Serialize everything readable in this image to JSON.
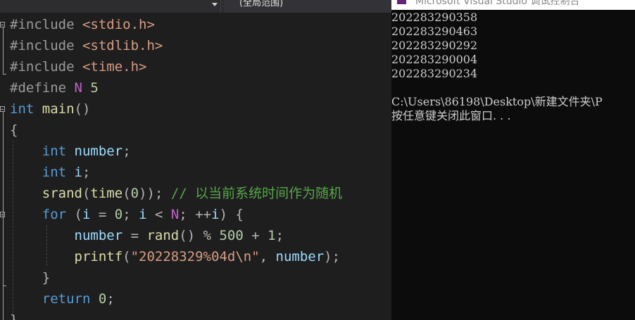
{
  "editor": {
    "function_scope": "(全局范围)",
    "code_lines": [
      {
        "tokens": [
          {
            "t": "#include ",
            "c": "pp"
          },
          {
            "t": "<stdio.h>",
            "c": "inc"
          }
        ]
      },
      {
        "tokens": [
          {
            "t": "#include ",
            "c": "pp"
          },
          {
            "t": "<stdlib.h>",
            "c": "inc"
          }
        ]
      },
      {
        "tokens": [
          {
            "t": "#include ",
            "c": "pp"
          },
          {
            "t": "<time.h>",
            "c": "inc"
          }
        ]
      },
      {
        "tokens": [
          {
            "t": "#define ",
            "c": "pp"
          },
          {
            "t": "N",
            "c": "macro"
          },
          {
            "t": " 5",
            "c": "num"
          }
        ]
      },
      {
        "tokens": [
          {
            "t": "int",
            "c": "kw"
          },
          {
            "t": " ",
            "c": ""
          },
          {
            "t": "main",
            "c": "fn"
          },
          {
            "t": "()",
            "c": "punc"
          }
        ]
      },
      {
        "tokens": [
          {
            "t": "{",
            "c": "punc"
          }
        ]
      },
      {
        "tokens": [
          {
            "t": "    ",
            "c": ""
          },
          {
            "t": "int",
            "c": "kw"
          },
          {
            "t": " ",
            "c": ""
          },
          {
            "t": "number",
            "c": "var"
          },
          {
            "t": ";",
            "c": "punc"
          }
        ]
      },
      {
        "tokens": [
          {
            "t": "    ",
            "c": ""
          },
          {
            "t": "int",
            "c": "kw"
          },
          {
            "t": " ",
            "c": ""
          },
          {
            "t": "i",
            "c": "var"
          },
          {
            "t": ";",
            "c": "punc"
          }
        ]
      },
      {
        "tokens": [
          {
            "t": "    ",
            "c": ""
          },
          {
            "t": "srand",
            "c": "fn"
          },
          {
            "t": "(",
            "c": "punc"
          },
          {
            "t": "time",
            "c": "fn"
          },
          {
            "t": "(",
            "c": "punc"
          },
          {
            "t": "0",
            "c": "num"
          },
          {
            "t": "));",
            "c": "punc"
          },
          {
            "t": " // 以当前系统时间作为随机",
            "c": "cmt"
          }
        ]
      },
      {
        "tokens": [
          {
            "t": "    ",
            "c": ""
          },
          {
            "t": "for",
            "c": "kw"
          },
          {
            "t": " (",
            "c": "punc"
          },
          {
            "t": "i",
            "c": "var"
          },
          {
            "t": " = ",
            "c": "punc"
          },
          {
            "t": "0",
            "c": "num"
          },
          {
            "t": "; ",
            "c": "punc"
          },
          {
            "t": "i",
            "c": "var"
          },
          {
            "t": " < ",
            "c": "punc"
          },
          {
            "t": "N",
            "c": "macro"
          },
          {
            "t": "; ++",
            "c": "punc"
          },
          {
            "t": "i",
            "c": "var"
          },
          {
            "t": ") {",
            "c": "punc"
          }
        ]
      },
      {
        "tokens": [
          {
            "t": "        ",
            "c": ""
          },
          {
            "t": "number",
            "c": "var"
          },
          {
            "t": " = ",
            "c": "punc"
          },
          {
            "t": "rand",
            "c": "fn"
          },
          {
            "t": "() % ",
            "c": "punc"
          },
          {
            "t": "500",
            "c": "num"
          },
          {
            "t": " + ",
            "c": "punc"
          },
          {
            "t": "1",
            "c": "num"
          },
          {
            "t": ";",
            "c": "punc"
          }
        ]
      },
      {
        "tokens": [
          {
            "t": "        ",
            "c": ""
          },
          {
            "t": "printf",
            "c": "fn"
          },
          {
            "t": "(",
            "c": "punc"
          },
          {
            "t": "\"20228329%04d\\n\"",
            "c": "str"
          },
          {
            "t": ", ",
            "c": "punc"
          },
          {
            "t": "number",
            "c": "var"
          },
          {
            "t": ");",
            "c": "punc"
          }
        ]
      },
      {
        "tokens": [
          {
            "t": "    ",
            "c": ""
          },
          {
            "t": "}",
            "c": "punc"
          }
        ]
      },
      {
        "tokens": [
          {
            "t": "    ",
            "c": ""
          },
          {
            "t": "return",
            "c": "kw"
          },
          {
            "t": " ",
            "c": ""
          },
          {
            "t": "0",
            "c": "num"
          },
          {
            "t": ";",
            "c": "punc"
          }
        ]
      },
      {
        "tokens": [
          {
            "t": "}",
            "c": "punc"
          }
        ]
      }
    ]
  },
  "console": {
    "title": "Microsoft Visual Studio 调试控制台",
    "output_lines": [
      "202283290358",
      "202283290463",
      "202283290292",
      "202283290004",
      "202283290234",
      "",
      "C:\\Users\\86198\\Desktop\\新建文件夹\\P",
      "按任意键关闭此窗口. . ."
    ]
  }
}
